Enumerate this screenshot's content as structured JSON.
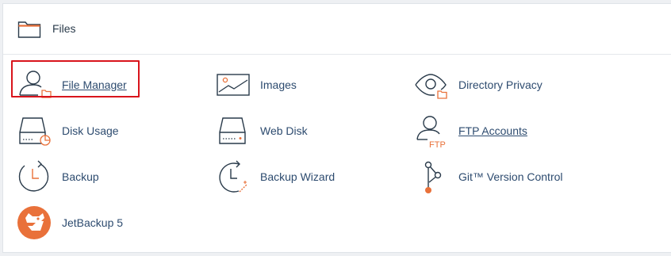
{
  "section": {
    "title": "Files",
    "icon": "folder-icon"
  },
  "items": [
    {
      "label": "File Manager",
      "icon": "user-folder-icon",
      "underlined": true,
      "highlighted": true
    },
    {
      "label": "Images",
      "icon": "image-icon"
    },
    {
      "label": "Directory Privacy",
      "icon": "eye-folder-icon"
    },
    {
      "label": "Disk Usage",
      "icon": "disk-pie-icon"
    },
    {
      "label": "Web Disk",
      "icon": "hard-drive-icon"
    },
    {
      "label": "FTP Accounts",
      "icon": "user-ftp-icon",
      "underlined": true
    },
    {
      "label": "Backup",
      "icon": "clock-backup-icon"
    },
    {
      "label": "Backup Wizard",
      "icon": "clock-wand-icon"
    },
    {
      "label": "Git™ Version Control",
      "icon": "git-branch-icon"
    },
    {
      "label": "JetBackup 5",
      "icon": "jetbackup-logo-icon"
    }
  ],
  "colors": {
    "accent": "#e9713a",
    "link": "#2d4b6f",
    "highlight_border": "#d9141c",
    "icon_stroke": "#293a4a"
  }
}
